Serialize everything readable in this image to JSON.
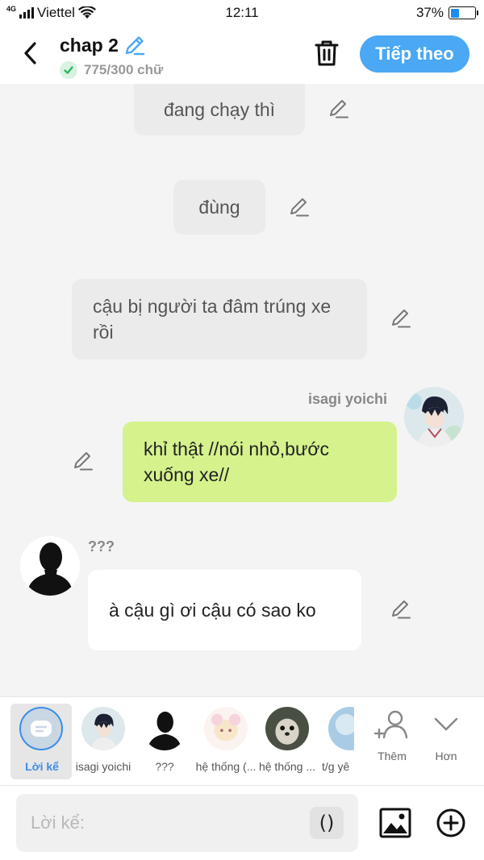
{
  "status_bar": {
    "network": "4G",
    "carrier": "Viettel",
    "time": "12:11",
    "battery_text": "37%",
    "battery_level": 0.37
  },
  "header": {
    "title": "chap 2",
    "word_count": "775/300 chữ",
    "next_label": "Tiếp theo"
  },
  "messages": [
    {
      "type": "narration",
      "text": "đang chạy thì"
    },
    {
      "type": "narration",
      "text": "đùng"
    },
    {
      "type": "narration",
      "text": "cậu bị người ta đâm trúng xe rồi"
    },
    {
      "type": "me",
      "speaker": "isagi yoichi",
      "text": "khỉ thật //nói nhỏ,bước xuống xe//"
    },
    {
      "type": "other",
      "speaker": "???",
      "text": "à cậu gì ơi cậu có sao ko"
    }
  ],
  "characters": [
    {
      "name": "Lời kể",
      "active": true
    },
    {
      "name": "isagi yoichi"
    },
    {
      "name": "???"
    },
    {
      "name": "hệ thống (..."
    },
    {
      "name": "hệ thống ..."
    },
    {
      "name": "t/g yê"
    }
  ],
  "more_label": "Thêm",
  "less_label": "Hơn",
  "input": {
    "placeholder": "Lời kể:",
    "paren": "()"
  },
  "colors": {
    "accent": "#4aa8f5",
    "my_bubble": "#d5f28c",
    "narration_bubble": "#ebebeb"
  }
}
